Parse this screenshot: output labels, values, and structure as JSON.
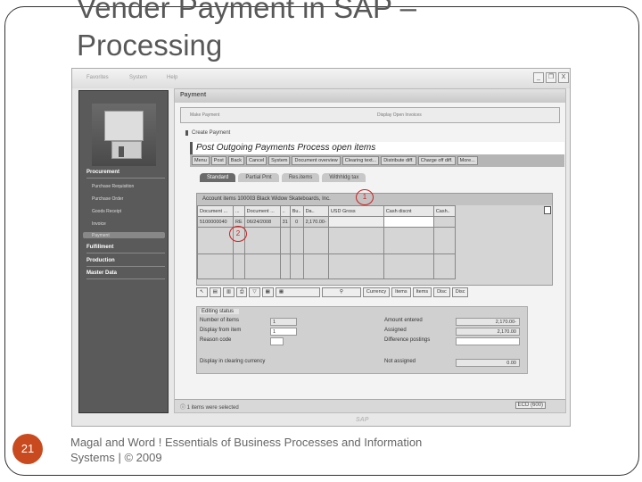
{
  "slide": {
    "title": "Vender Payment in SAP – Processing",
    "number": "21",
    "footer": "Magal and Word ! Essentials of Business Processes and Information Systems | © 2009"
  },
  "sap": {
    "menu": [
      "Favorites",
      "System",
      "Help"
    ],
    "window_buttons": [
      "_",
      "❐",
      "X"
    ],
    "sidebar": {
      "sections": [
        {
          "label": "Procurement",
          "items": [
            "Purchase Requisition",
            "Purchase Order",
            "Goods Receipt",
            "Invoice",
            "Payment"
          ],
          "selected": "Payment"
        },
        {
          "label": "Fulfillment"
        },
        {
          "label": "Production"
        },
        {
          "label": "Master Data"
        }
      ]
    },
    "panel_title": "Payment",
    "toolbar": [
      "Make Payment",
      "Display Open Invoices"
    ],
    "section": "Create Payment",
    "page_title": "Post Outgoing Payments Process open items",
    "buttons": [
      "Menu",
      "Post",
      "Back",
      "Cancel",
      "System",
      "Document overview",
      "Clearing text...",
      "Distribute diff.",
      "Charge off diff.",
      "More..."
    ],
    "tabs": [
      "Standard",
      "Partial Pmt",
      "Res.items",
      "Withhldg tax"
    ],
    "active_tab": "Standard",
    "account_items": "Account items 100003 Black Widow Skateboards, Inc.",
    "columns": [
      "Document ...",
      "...",
      "Document ...",
      "..",
      "Bu..",
      "Da..",
      "USD Gross",
      "Cash discnt",
      "Cash.."
    ],
    "rows": [
      [
        "5100000040",
        "RE",
        "06/24/2008",
        "31",
        "0",
        "2,170.00-",
        "",
        ""
      ]
    ],
    "annotations": [
      "1",
      "2"
    ],
    "icon_buttons": [
      "Currency",
      "Items",
      "Items",
      "Disc",
      "Disc"
    ],
    "editing": {
      "title": "Editing status",
      "number_of_items_label": "Number of items",
      "number_of_items": "1",
      "display_from_item_label": "Display from item",
      "display_from_item": "1",
      "reason_code_label": "Reason code",
      "display_clearing_label": "Display in clearing currency",
      "amount_entered_label": "Amount entered",
      "amount_entered": "2,170.00-",
      "assigned_label": "Assigned",
      "assigned": "2,170.00",
      "difference_label": "Difference postings",
      "not_assigned_label": "Not assigned",
      "not_assigned": "0.00"
    },
    "status": "1 items were selected",
    "system": "ECD (600)"
  },
  "colors": {
    "accent": "#c94a1e",
    "sidebar": "#5a5a5a"
  }
}
